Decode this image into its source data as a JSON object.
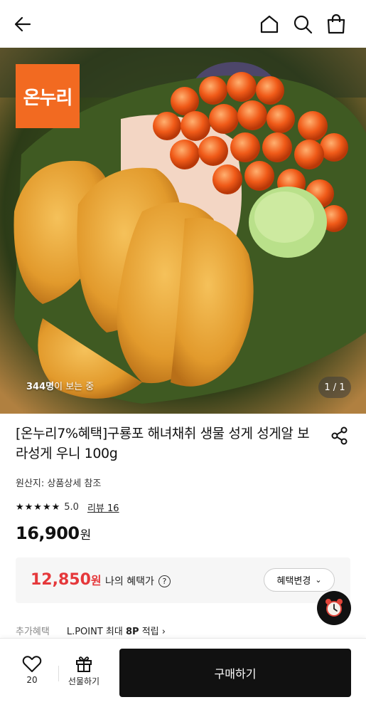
{
  "header": {
    "back_icon": "arrow-left-icon",
    "home_icon": "home-icon",
    "search_icon": "search-icon",
    "cart_icon": "shopping-bag-icon"
  },
  "hero": {
    "logo_text": "온누리",
    "viewers_count": "344명",
    "viewers_suffix": "이 보는 중",
    "pager": "1 / 1",
    "logo_color": "#f26a21"
  },
  "product": {
    "title": "[온누리7%혜택]구룡포 해녀채취 생물 성게 성게알 보라성게 우니 100g",
    "origin": "원산지: 상품상세 참조",
    "stars": "★★★★★",
    "rating": "5.0",
    "review_link": "리뷰 16",
    "price": "16,900",
    "price_unit": "원"
  },
  "benefit": {
    "price": "12,850",
    "price_unit": "원",
    "label": "나의 혜택가",
    "help_icon": "question-circle-icon",
    "help_glyph": "?",
    "change_button": "혜택변경",
    "accent_color": "#e5383b"
  },
  "extra": {
    "label": "추가혜택",
    "point_prefix": "L.POINT 최대 ",
    "point_value": "8P",
    "point_suffix": " 적립 ›"
  },
  "bottom": {
    "like_count": "20",
    "gift_label": "선물하기",
    "buy_label": "구매하기"
  }
}
